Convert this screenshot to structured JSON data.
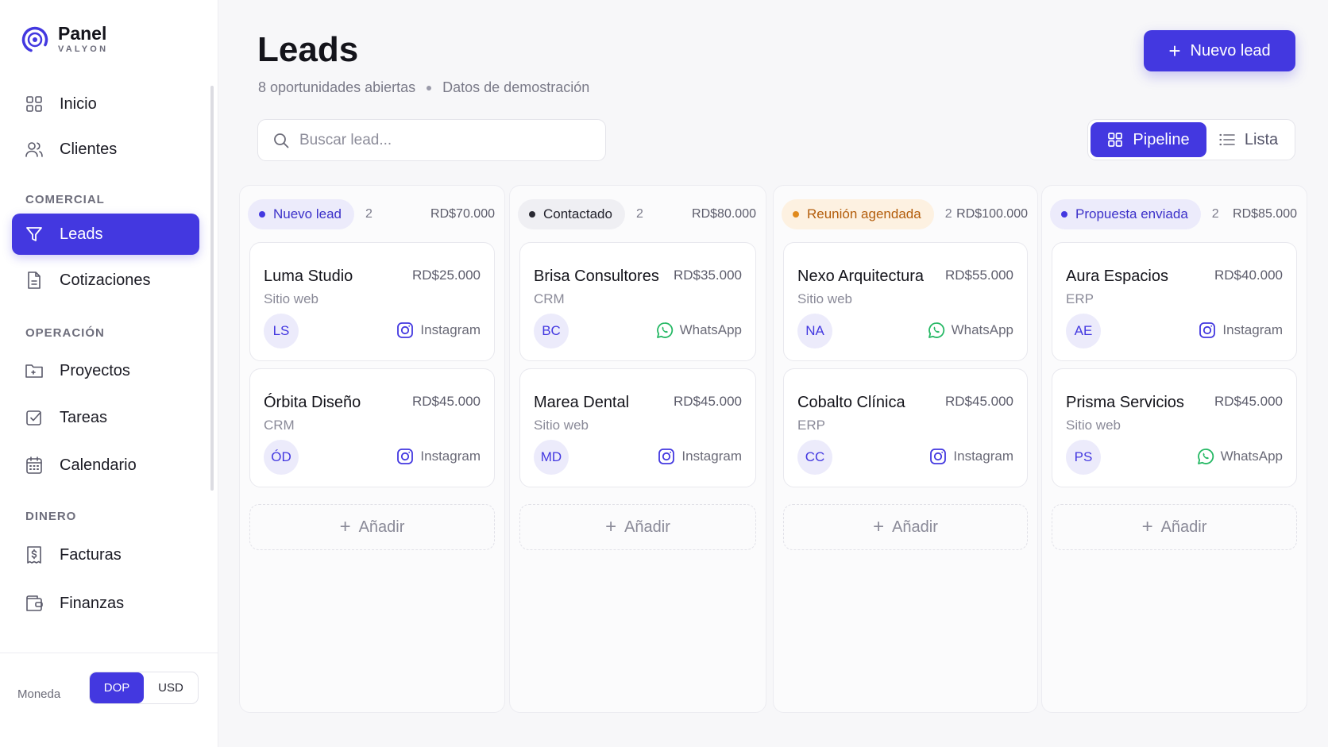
{
  "brand": {
    "name": "Panel",
    "sub": "VALYON"
  },
  "sidebar": {
    "items": [
      {
        "label": "Inicio",
        "icon": "grid-icon"
      },
      {
        "label": "Clientes",
        "icon": "users-icon"
      },
      {
        "label": "Leads",
        "icon": "funnel-icon",
        "active": true
      },
      {
        "label": "Cotizaciones",
        "icon": "document-icon"
      },
      {
        "label": "Proyectos",
        "icon": "folder-icon"
      },
      {
        "label": "Tareas",
        "icon": "checkbox-icon"
      },
      {
        "label": "Calendario",
        "icon": "calendar-icon"
      },
      {
        "label": "Facturas",
        "icon": "invoice-icon"
      },
      {
        "label": "Finanzas",
        "icon": "wallet-icon"
      }
    ],
    "sections": {
      "comercial": "COMERCIAL",
      "operacion": "OPERACIÓN",
      "dinero": "DINERO"
    },
    "currency": {
      "label": "Moneda",
      "options": [
        "DOP",
        "USD"
      ],
      "selected": "DOP"
    }
  },
  "header": {
    "title": "Leads",
    "open_count": "8 oportunidades abiertas",
    "demo_note": "Datos de demostración",
    "new_button": "Nuevo lead"
  },
  "search": {
    "placeholder": "Buscar lead..."
  },
  "view_toggle": {
    "pipeline": "Pipeline",
    "list": "Lista",
    "selected": "Pipeline"
  },
  "colors": {
    "accent": "#4338e0",
    "whatsapp": "#25b864",
    "instagram": "#4338e0"
  },
  "board": {
    "add_label": "Añadir",
    "columns": [
      {
        "stage": "Nuevo lead",
        "count": "2",
        "total": "RD$70.000",
        "pill_bg": "#ecebfb",
        "pill_fg": "#3b30c9",
        "dot": "#4338e0",
        "cards": [
          {
            "name": "Luma Studio",
            "amount": "RD$25.000",
            "type": "Sitio web",
            "initials": "LS",
            "source": "Instagram",
            "source_icon": "instagram-icon"
          },
          {
            "name": "Órbita Diseño",
            "amount": "RD$45.000",
            "type": "CRM",
            "initials": "ÓD",
            "source": "Instagram",
            "source_icon": "instagram-icon"
          }
        ]
      },
      {
        "stage": "Contactado",
        "count": "2",
        "total": "RD$80.000",
        "pill_bg": "#efeff3",
        "pill_fg": "#22222c",
        "dot": "#2a2a33",
        "cards": [
          {
            "name": "Brisa Consultores",
            "amount": "RD$35.000",
            "type": "CRM",
            "initials": "BC",
            "source": "WhatsApp",
            "source_icon": "whatsapp-icon"
          },
          {
            "name": "Marea Dental",
            "amount": "RD$45.000",
            "type": "Sitio web",
            "initials": "MD",
            "source": "Instagram",
            "source_icon": "instagram-icon"
          }
        ]
      },
      {
        "stage": "Reunión agendada",
        "count": "2",
        "total": "RD$100.000",
        "pill_bg": "#fdf1e1",
        "pill_fg": "#b35c0a",
        "dot": "#e08a1e",
        "cards": [
          {
            "name": "Nexo Arquitectura",
            "amount": "RD$55.000",
            "type": "Sitio web",
            "initials": "NA",
            "source": "WhatsApp",
            "source_icon": "whatsapp-icon"
          },
          {
            "name": "Cobalto Clínica",
            "amount": "RD$45.000",
            "type": "ERP",
            "initials": "CC",
            "source": "Instagram",
            "source_icon": "instagram-icon"
          }
        ]
      },
      {
        "stage": "Propuesta enviada",
        "count": "2",
        "total": "RD$85.000",
        "pill_bg": "#ecebfb",
        "pill_fg": "#3b30c9",
        "dot": "#4338e0",
        "cards": [
          {
            "name": "Aura Espacios",
            "amount": "RD$40.000",
            "type": "ERP",
            "initials": "AE",
            "source": "Instagram",
            "source_icon": "instagram-icon"
          },
          {
            "name": "Prisma Servicios",
            "amount": "RD$45.000",
            "type": "Sitio web",
            "initials": "PS",
            "source": "WhatsApp",
            "source_icon": "whatsapp-icon"
          }
        ]
      }
    ]
  }
}
